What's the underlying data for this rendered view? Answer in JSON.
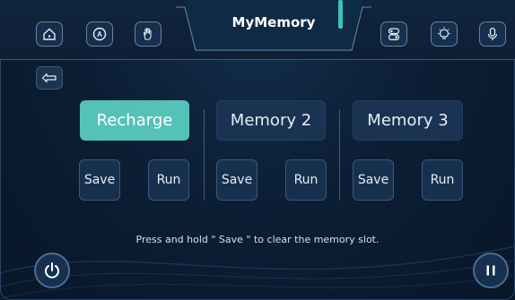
{
  "header": {
    "title": "MyMemory",
    "accent_color": "#39c6b7",
    "left_icons": [
      "home-icon",
      "auto-mode-icon",
      "hand-icon"
    ],
    "right_icons": [
      "toggle-switch-icon",
      "light-bulb-icon",
      "microphone-icon"
    ]
  },
  "nav": {
    "back_icon": "back-arrow-icon"
  },
  "memory_slots": [
    {
      "label": "Recharge",
      "active": true,
      "save_label": "Save",
      "run_label": "Run"
    },
    {
      "label": "Memory 2",
      "active": false,
      "save_label": "Save",
      "run_label": "Run"
    },
    {
      "label": "Memory 3",
      "active": false,
      "save_label": "Save",
      "run_label": "Run"
    }
  ],
  "hint_text": "Press and hold \" Save \" to clear the memory slot.",
  "footer": {
    "left_icon": "power-icon",
    "right_icon": "pause-icon"
  },
  "colors": {
    "active_slot": "#54c2b6",
    "background": "#0c1f36"
  }
}
